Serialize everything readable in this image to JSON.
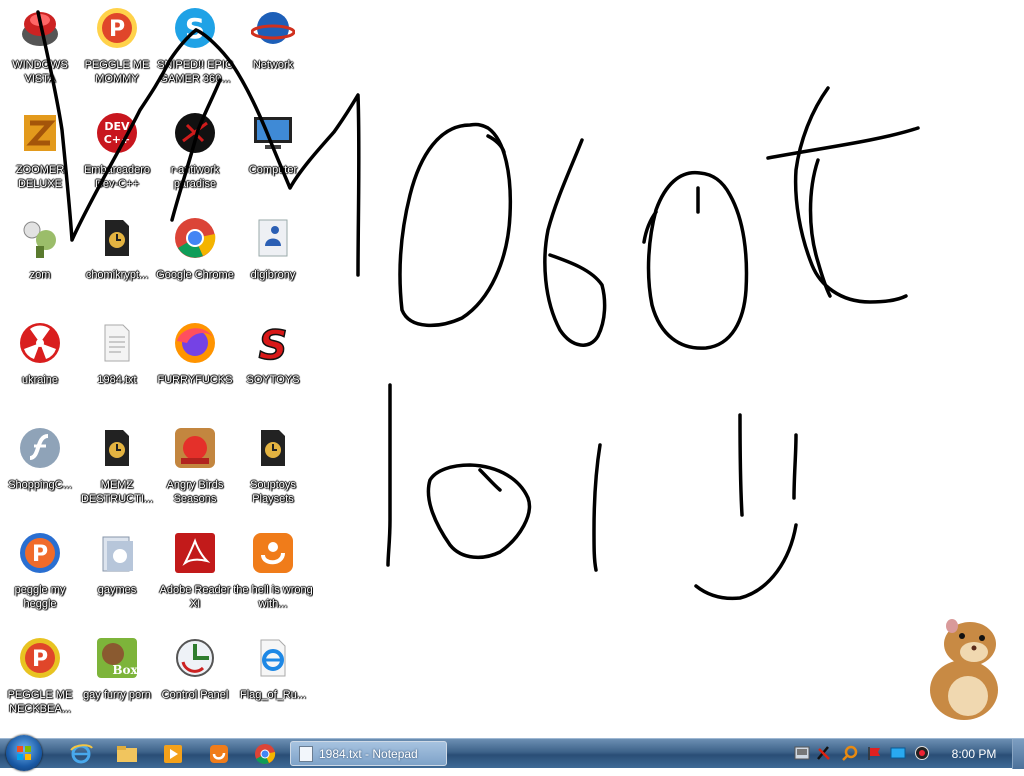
{
  "desktop": {
    "icons": [
      {
        "label": "WINDOWS VISTA",
        "icon": "vista-orb-icon"
      },
      {
        "label": "PEGGLE ME MOMMY",
        "icon": "peggle-icon"
      },
      {
        "label": "SNIPED!! EPIC GAMER 360...",
        "icon": "skype-icon"
      },
      {
        "label": "Network",
        "icon": "network-globe-icon"
      },
      {
        "label": "ZOOMER DELUXE",
        "icon": "zuma-icon"
      },
      {
        "label": "Embarcadero Dev-C++",
        "icon": "devcpp-icon"
      },
      {
        "label": "r-antiwork paradise",
        "icon": "paradise-icon"
      },
      {
        "label": "Computer",
        "icon": "computer-monitor-icon"
      },
      {
        "label": "zom",
        "icon": "zombie-icon"
      },
      {
        "label": "chomikrypt...",
        "icon": "lnk-file-icon"
      },
      {
        "label": "Google Chrome",
        "icon": "chrome-icon"
      },
      {
        "label": "digibrony",
        "icon": "shortcut-app-icon"
      },
      {
        "label": "ukraine",
        "icon": "radiation-icon"
      },
      {
        "label": "1984.txt",
        "icon": "text-file-icon"
      },
      {
        "label": "FURRYFUCKS",
        "icon": "firefox-icon"
      },
      {
        "label": "SOYTOYS",
        "icon": "soytoys-s-icon"
      },
      {
        "label": "ShoppingC...",
        "icon": "flash-icon"
      },
      {
        "label": "MEMZ DESTRUCTI...",
        "icon": "lnk-file-icon"
      },
      {
        "label": "Angry Birds Seasons",
        "icon": "angry-birds-icon"
      },
      {
        "label": "Souptoys Playsets",
        "icon": "lnk-file-icon"
      },
      {
        "label": "peggle my heggle",
        "icon": "peggle-icon"
      },
      {
        "label": "gaymes",
        "icon": "games-folder-icon"
      },
      {
        "label": "Adobe Reader XI",
        "icon": "adobe-reader-icon"
      },
      {
        "label": "the hell is wrong with...",
        "icon": "uc-browser-icon"
      },
      {
        "label": "PEGGLE ME NECKBEA...",
        "icon": "peggle-icon"
      },
      {
        "label": "gay furry porn",
        "icon": "box-beaver-icon"
      },
      {
        "label": "Control Panel",
        "icon": "control-panel-icon"
      },
      {
        "label": "Flag_of_Ru...",
        "icon": "internet-explorer-icon"
      }
    ]
  },
  "taskbar": {
    "active_window": "1984.txt - Notepad",
    "clock": "8:00 PM",
    "pinned": [
      "internet-explorer-icon",
      "folder-icon",
      "media-player-icon",
      "uc-browser-icon",
      "chrome-icon"
    ],
    "tray": [
      "network-tray-icon",
      "security-flag-icon",
      "search-tray-icon",
      "flag-tray-icon",
      "display-tray-icon",
      "volume-tray-icon"
    ]
  },
  "colors": {
    "taskbar": "#3d6289",
    "label_text": "#ffffff",
    "ink": "#000000"
  }
}
